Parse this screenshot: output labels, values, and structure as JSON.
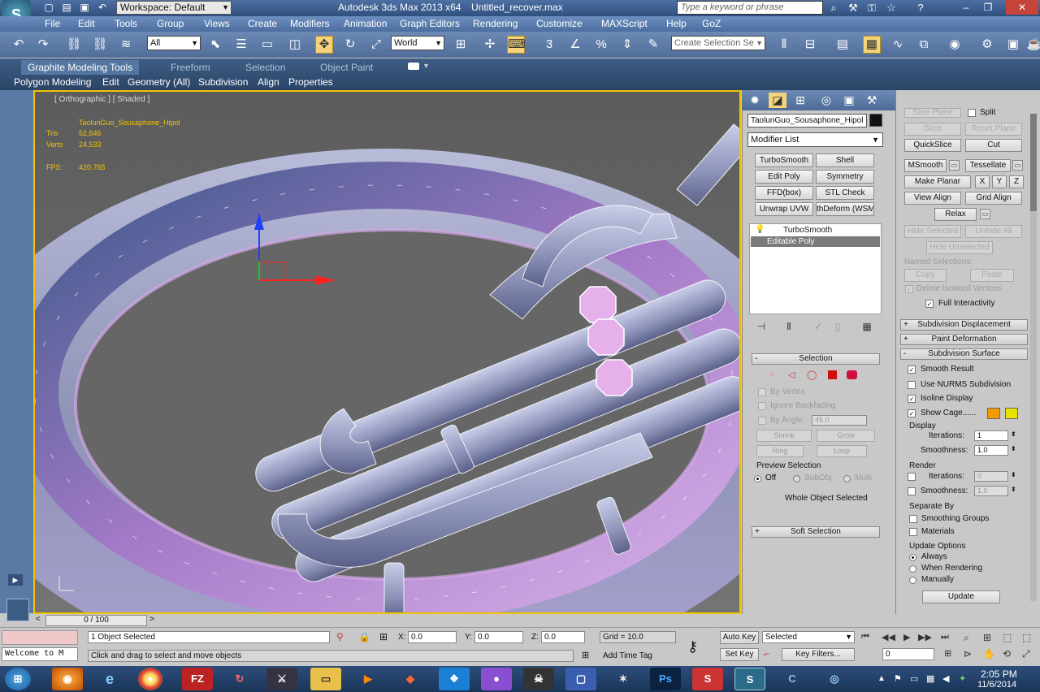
{
  "titlebar": {
    "workspace": "Workspace: Default",
    "app_title": "Autodesk 3ds Max  2013 x64",
    "doc_title": "Untitled_recover.max",
    "search_placeholder": "Type a keyword or phrase"
  },
  "menubar": [
    "File",
    "Edit",
    "Tools",
    "Group",
    "Views",
    "Create",
    "Modifiers",
    "Animation",
    "Graph Editors",
    "Rendering",
    "Customize",
    "MAXScript",
    "Help",
    "GoZ"
  ],
  "toolbar": {
    "filter": "All",
    "coord_system": "World",
    "named_selection_placeholder": "Create Selection Se"
  },
  "ribbon": {
    "tabs": [
      "Graphite Modeling Tools",
      "Freeform",
      "Selection",
      "Object Paint"
    ],
    "subtabs": [
      "Polygon Modeling",
      "Edit",
      "Geometry (All)",
      "Subdivision",
      "Align",
      "Properties"
    ]
  },
  "viewport": {
    "label": "[ Orthographic ] [ Shaded ]",
    "object_name": "TaolunGuo_Sousaphone_Hipol",
    "stat_tris_label": "Tris",
    "stat_tris": "52,646",
    "stat_verts_label": "Verts",
    "stat_verts": "24,533",
    "fps_label": "FPS:",
    "fps": "420.765"
  },
  "cmdpanel": {
    "object_name": "TaolunGuo_Sousaphone_Hipol",
    "object_color": "#111111",
    "modifier_list": "Modifier List",
    "mod_buttons": [
      "TurboSmooth",
      "Shell",
      "Edit Poly",
      "Symmetry",
      "FFD(box)",
      "STL Check",
      "Unwrap UVW",
      "thDeform (WSM"
    ],
    "stack": [
      "TurboSmooth",
      "Editable Poly"
    ],
    "selection": {
      "title": "Selection",
      "by_vertex": "By Vertex",
      "ignore_backfacing": "Ignore Backfacing",
      "by_angle": "By Angle:",
      "by_angle_value": "45.0",
      "shrink": "Shrink",
      "grow": "Grow",
      "ring": "Ring",
      "loop": "Loop",
      "preview_title": "Preview Selection",
      "preview_off": "Off",
      "preview_subobj": "SubObj",
      "preview_multi": "Multi",
      "status": "Whole Object Selected"
    },
    "soft_selection": "Soft Selection"
  },
  "graphite": {
    "slice_plane": "Slice Plane",
    "split": "Split",
    "slice": "Slice",
    "reset_plane": "Reset Plane",
    "quickslice": "QuickSlice",
    "cut": "Cut",
    "msmooth": "MSmooth",
    "tessellate": "Tessellate",
    "make_planar": "Make Planar",
    "x": "X",
    "y": "Y",
    "z": "Z",
    "view_align": "View Align",
    "grid_align": "Grid Align",
    "relax": "Relax",
    "hide_selected": "Hide Selected",
    "unhide_all": "Unhide All",
    "hide_unselected": "Hide Unselected",
    "named_selections": "Named Selections:",
    "copy": "Copy",
    "paste": "Paste",
    "delete_isolated": "Delete Isolated Vertices",
    "full_interactivity": "Full Interactivity",
    "subdiv_displacement": "Subdivision Displacement",
    "paint_deformation": "Paint Deformation",
    "subdiv_surface": "Subdivision Surface",
    "smooth_result": "Smooth Result",
    "use_nurms": "Use NURMS Subdivision",
    "isoline_display": "Isoline Display",
    "show_cage": "Show Cage......",
    "cage_color_1": "#f39a00",
    "cage_color_2": "#e8e000",
    "display": "Display",
    "iterations_label": "Iterations:",
    "display_iterations": "1",
    "smoothness_label": "Smoothness:",
    "display_smoothness": "1.0",
    "render": "Render",
    "render_iterations": "0",
    "render_smoothness": "1.0",
    "separate_by": "Separate By",
    "smoothing_groups": "Smoothing Groups",
    "materials": "Materials",
    "update_options": "Update Options",
    "always": "Always",
    "when_rendering": "When Rendering",
    "manually": "Manually",
    "update": "Update"
  },
  "timeline": {
    "frame": "0 / 100",
    "prev": "<",
    "next": ">"
  },
  "status": {
    "selected": "1 Object Selected",
    "hint": "Click and drag to select and move objects",
    "maxscript": "Welcome to M",
    "x_label": "X:",
    "x": "0.0",
    "y_label": "Y:",
    "y": "0.0",
    "z_label": "Z:",
    "z": "0.0",
    "grid": "Grid = 10.0",
    "add_time_tag": "Add Time Tag",
    "auto_key": "Auto Key",
    "set_key": "Set Key",
    "key_mode": "Selected",
    "key_filters": "Key Filters...",
    "frame_field": "0"
  },
  "taskbar": {
    "time": "2:05 PM",
    "date": "11/6/2014"
  }
}
